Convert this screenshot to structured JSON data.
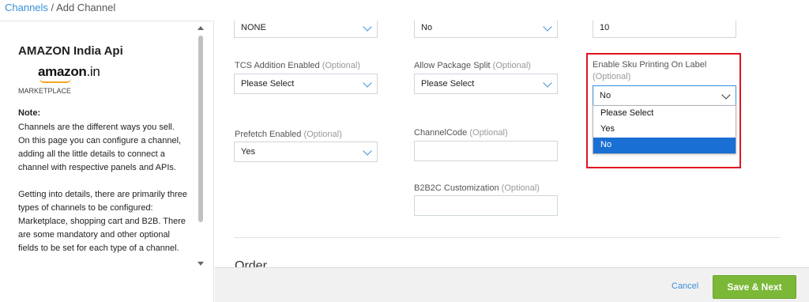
{
  "breadcrumb": {
    "parent": "Channels",
    "separator": " / ",
    "current": "Add Channel"
  },
  "sidebar": {
    "title": "AMAZON India Api",
    "logo_text": "amazon",
    "logo_tld": ".in",
    "channel_type": "MARKETPLACE",
    "note_heading": "Note:",
    "note_paragraphs": [
      "Channels are the different ways you sell. On this page you can configure a channel, adding all the little details to connect a channel with respective panels and APIs.",
      "Getting into details, there are primarily three types of channels to be configured: Marketplace, shopping cart and B2B. There are some mandatory and other optional fields to be set for each type of a channel."
    ]
  },
  "form": {
    "row0": {
      "col1_value": "NONE",
      "col2_value": "No",
      "col3_value": "10"
    },
    "tcs": {
      "label": "TCS Addition Enabled",
      "optional": "(Optional)",
      "value": "Please Select"
    },
    "package_split": {
      "label": "Allow Package Split",
      "optional": "(Optional)",
      "value": "Please Select"
    },
    "sku_printing": {
      "label": "Enable Sku Printing On Label",
      "optional": "(Optional)",
      "value": "No",
      "options": [
        "Please Select",
        "Yes",
        "No"
      ],
      "selected_option": "No"
    },
    "prefetch": {
      "label": "Prefetch Enabled",
      "optional": "(Optional)",
      "value": "Yes"
    },
    "channel_code": {
      "label": "ChannelCode",
      "optional": "(Optional)",
      "value": ""
    },
    "b2b2c": {
      "label": "B2B2C Customization",
      "optional": "(Optional)",
      "value": ""
    },
    "section_title": "Order"
  },
  "footer": {
    "cancel_label": "Cancel",
    "save_label": "Save & Next"
  },
  "colors": {
    "accent": "#3a8fd6",
    "save_green": "#7bb838",
    "highlight_red": "#e0141e",
    "selected_blue": "#1a6fd4"
  }
}
